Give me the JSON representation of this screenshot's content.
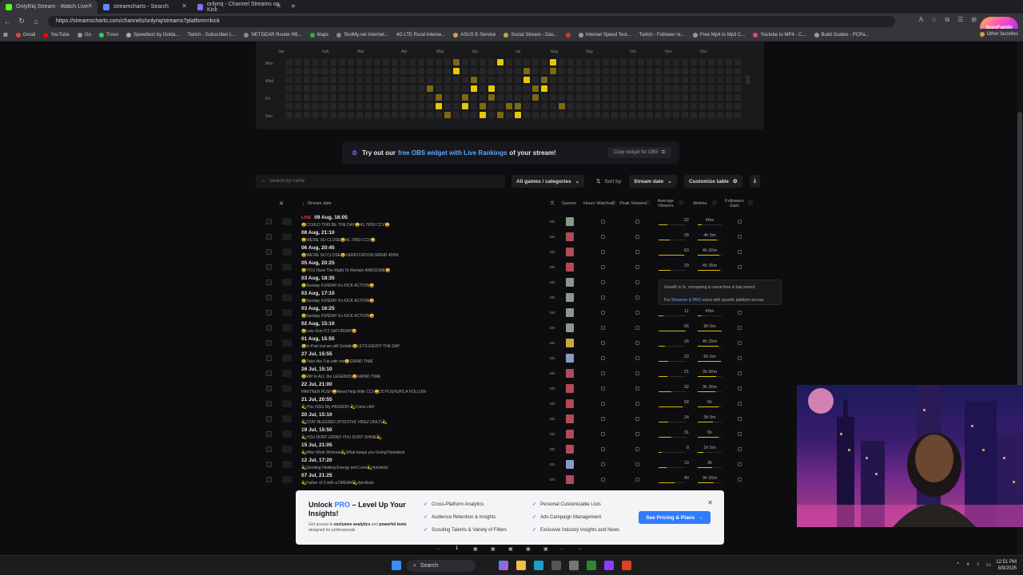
{
  "browser": {
    "tabs": [
      {
        "label": "OnlyRiq Stream - Watch Live",
        "color": "#53fc18"
      },
      {
        "label": "streamcharts - Search",
        "color": "#5a8cff"
      },
      {
        "label": "onlyriq - Channel Streams on Kick",
        "color": "#8a6cff"
      }
    ],
    "url": "https://streamscharts.com/channels/onlyriq/streams?platform=kick",
    "bookmarks": [
      "Gmail",
      "YouTube",
      "Go",
      "Trovo",
      "Speedtest by Ookla...",
      "Twitch - Subscriber L...",
      "NETGEAR Router R6...",
      "Maps",
      "TestMy.net Internet...",
      "4G LTE Rural Interne...",
      "ASUS E-Service",
      "Social Stream - Das...",
      "Internet Speed Test...",
      "Twitch - Follower re...",
      "Free Mp4 to Mp3 C...",
      "Youtube to MP4 - C...",
      "Build Guides - PCPa..."
    ],
    "other_favorites": "Other favorites",
    "avatar_label": "ScoeFamily"
  },
  "heatmap": {
    "months": [
      "Jan",
      "Feb",
      "Mar",
      "Apr",
      "May",
      "Jun",
      "Jul",
      "Aug",
      "Sep",
      "Oct",
      "Nov",
      "Dec"
    ],
    "days": [
      "Mon",
      "Wed",
      "Fri",
      "Sun"
    ],
    "year": "2025",
    "accent": "#e8c800"
  },
  "obs_banner": {
    "pre": "Try out our",
    "highlight": "free OBS widget with Live Rankings",
    "post": "of your stream!",
    "button": "Copy widget for OBS"
  },
  "toolbar": {
    "search_placeholder": "Search by name",
    "games_filter": "All games / categories",
    "sort_label": "Sort by:",
    "sort_value": "Stream date",
    "customize": "Customize table"
  },
  "table": {
    "headers": {
      "stream_date": "Stream date",
      "games": "Games",
      "hours_watched": "Hours Watched",
      "peak_viewers": "Peak Viewers",
      "average_viewers": "Average Viewers",
      "airtime": "Airtime",
      "followers_gain": "Followers Gain"
    },
    "rows": [
      {
        "live": "LIVE",
        "date": "09 Aug, 16:05",
        "title": "😀COULD THIS BE THE DAY😀41.79/50 CCV😀",
        "avg": "22",
        "avg_frac": 0.33,
        "air": "45m",
        "air_frac": 0.15,
        "game": "#8a9a8a"
      },
      {
        "live": "",
        "date": "08 Aug, 21:10",
        "title": "😀WE'RE SO CLOSE😀41.79/50 CCV😀",
        "avg": "28",
        "avg_frac": 0.42,
        "air": "4h 5m",
        "air_frac": 0.8,
        "game": "#b04a5a"
      },
      {
        "live": "",
        "date": "06 Aug, 20:45",
        "title": "😀WE'RE SO CLOSE😀VERIFICATION GRIND 40/50",
        "avg": "63",
        "avg_frac": 0.95,
        "air": "4h 30m",
        "air_frac": 0.9,
        "game": "#b04a5a"
      },
      {
        "live": "",
        "date": "05 Aug, 20:25",
        "title": "😀YOU Have The Right To Remain AWESOME😀",
        "avg": "29",
        "avg_frac": 0.44,
        "air": "4h 35m",
        "air_frac": 0.92,
        "game": "#b04a5a"
      },
      {
        "live": "",
        "date": "03 Aug, 18:35",
        "title": "😀Sunday FUNDAY it's KICK ACTION😀",
        "avg": "",
        "avg_frac": 0,
        "air": "",
        "air_frac": 0,
        "game": "#8a9a8a"
      },
      {
        "live": "",
        "date": "03 Aug, 17:10",
        "title": "😀Sunday FUNDAY it's KICK ACTION😀",
        "avg": "",
        "avg_frac": 0,
        "air": "",
        "air_frac": 0,
        "game": "#8a9a8a"
      },
      {
        "live": "",
        "date": "03 Aug, 16:25",
        "title": "😀Sunday FUNDAY it's KICK ACTION😀",
        "avg": "11",
        "avg_frac": 0.17,
        "air": "45m",
        "air_frac": 0.15,
        "game": "#8a9a8a"
      },
      {
        "live": "",
        "date": "02 Aug, 15:10",
        "title": "😀Lets Gon ITZ SATURDAY😀",
        "avg": "66",
        "avg_frac": 1.0,
        "air": "9h 5m",
        "air_frac": 1.0,
        "game": "#8a9a8a"
      },
      {
        "live": "",
        "date": "01 Aug, 15:55",
        "title": "😀In Pain but we still Grindin😀LETS ENJOY THE DAY",
        "avg": "16",
        "avg_frac": 0.24,
        "air": "4h 25m",
        "air_frac": 0.88,
        "game": "#c9a63a"
      },
      {
        "live": "",
        "date": "27 Jul, 15:55",
        "title": "😀Take this Trip with me😀GRIND TIME",
        "avg": "23",
        "avg_frac": 0.35,
        "air": "6h 5m",
        "air_frac": 0.95,
        "game": "#8a9ac8"
      },
      {
        "live": "",
        "date": "26 Jul, 15:10",
        "title": "😀RIP to ALL the LEGENDS😀GRIND TIME",
        "avg": "21",
        "avg_frac": 0.32,
        "air": "3h 50m",
        "air_frac": 0.76,
        "game": "#b04a5a"
      },
      {
        "live": "",
        "date": "22 Jul, 21:00",
        "title": "PARTNER PUSH😀Need Help With CCV😀20 PUSHUPS A FOLLOW",
        "avg": "32",
        "avg_frac": 0.48,
        "air": "3h 35m",
        "air_frac": 0.72,
        "game": "#b04a5a"
      },
      {
        "live": "",
        "date": "21 Jul, 20:55",
        "title": "💫This ISSS My PASSION 💫Come chill",
        "avg": "58",
        "avg_frac": 0.88,
        "air": "5h",
        "air_frac": 0.85,
        "game": "#b04a5a"
      },
      {
        "live": "",
        "date": "20 Jul, 15:10",
        "title": "💫STAY BLESSED (POSITIVE VIBEZ ONLY)💫",
        "avg": "24",
        "avg_frac": 0.36,
        "air": "3h 5m",
        "air_frac": 0.62,
        "game": "#b04a5a"
      },
      {
        "live": "",
        "date": "19 Jul, 15:50",
        "title": "💫YOU DONT GRIND YOU DONT SHINE💫",
        "avg": "31",
        "avg_frac": 0.47,
        "air": "5h",
        "air_frac": 0.85,
        "game": "#b04a5a"
      },
      {
        "live": "",
        "date": "15 Jul, 21:05",
        "title": "💫After Work Workout💫What keeps you Going?#pickkick",
        "avg": "8",
        "avg_frac": 0.12,
        "air": "1h 5m",
        "air_frac": 0.22,
        "game": "#b04a5a"
      },
      {
        "live": "",
        "date": "12 Jul, 17:20",
        "title": "💫Sending Healing Energy and Love💫#pickkick",
        "avg": "19",
        "avg_frac": 0.29,
        "air": "3h",
        "air_frac": 0.6,
        "game": "#8a9ac8"
      },
      {
        "live": "",
        "date": "07 Jul, 21:25",
        "title": "💫Father of 3 with a DREAM💫#pickkick",
        "avg": "40",
        "avg_frac": 0.6,
        "air": "3h 20m",
        "air_frac": 0.66,
        "game": "#b04a5a"
      }
    ]
  },
  "tooltip": {
    "line1": "Growth in %, comparing to same time in last period.",
    "line2_pre": "For",
    "line2_hl": "Streamer & PRO",
    "line2_post": "users with specific platform access"
  },
  "promo": {
    "title_pre": "Unlock",
    "title_pro": "PRO",
    "title_post": "– Level Up Your Insights!",
    "sub_pre": "Get access to",
    "sub_b1": "exclusive analytics",
    "sub_mid": "and",
    "sub_b2": "powerful tools",
    "sub_post": "designed for professionals",
    "features": [
      "Cross-Platform Analytics",
      "Personal Customizable Lists",
      "Audience Retention & Insights",
      "Ads Campaign Management",
      "Scouting Talents & Variety of Filters",
      "Exclusive Industry Insights and News"
    ],
    "button": "See Pricing & Plans"
  },
  "pagination": {
    "current": "1",
    "ellipsis": "..."
  },
  "taskbar": {
    "search": "Search",
    "time": "12:51 PM",
    "date": "8/9/2025"
  }
}
